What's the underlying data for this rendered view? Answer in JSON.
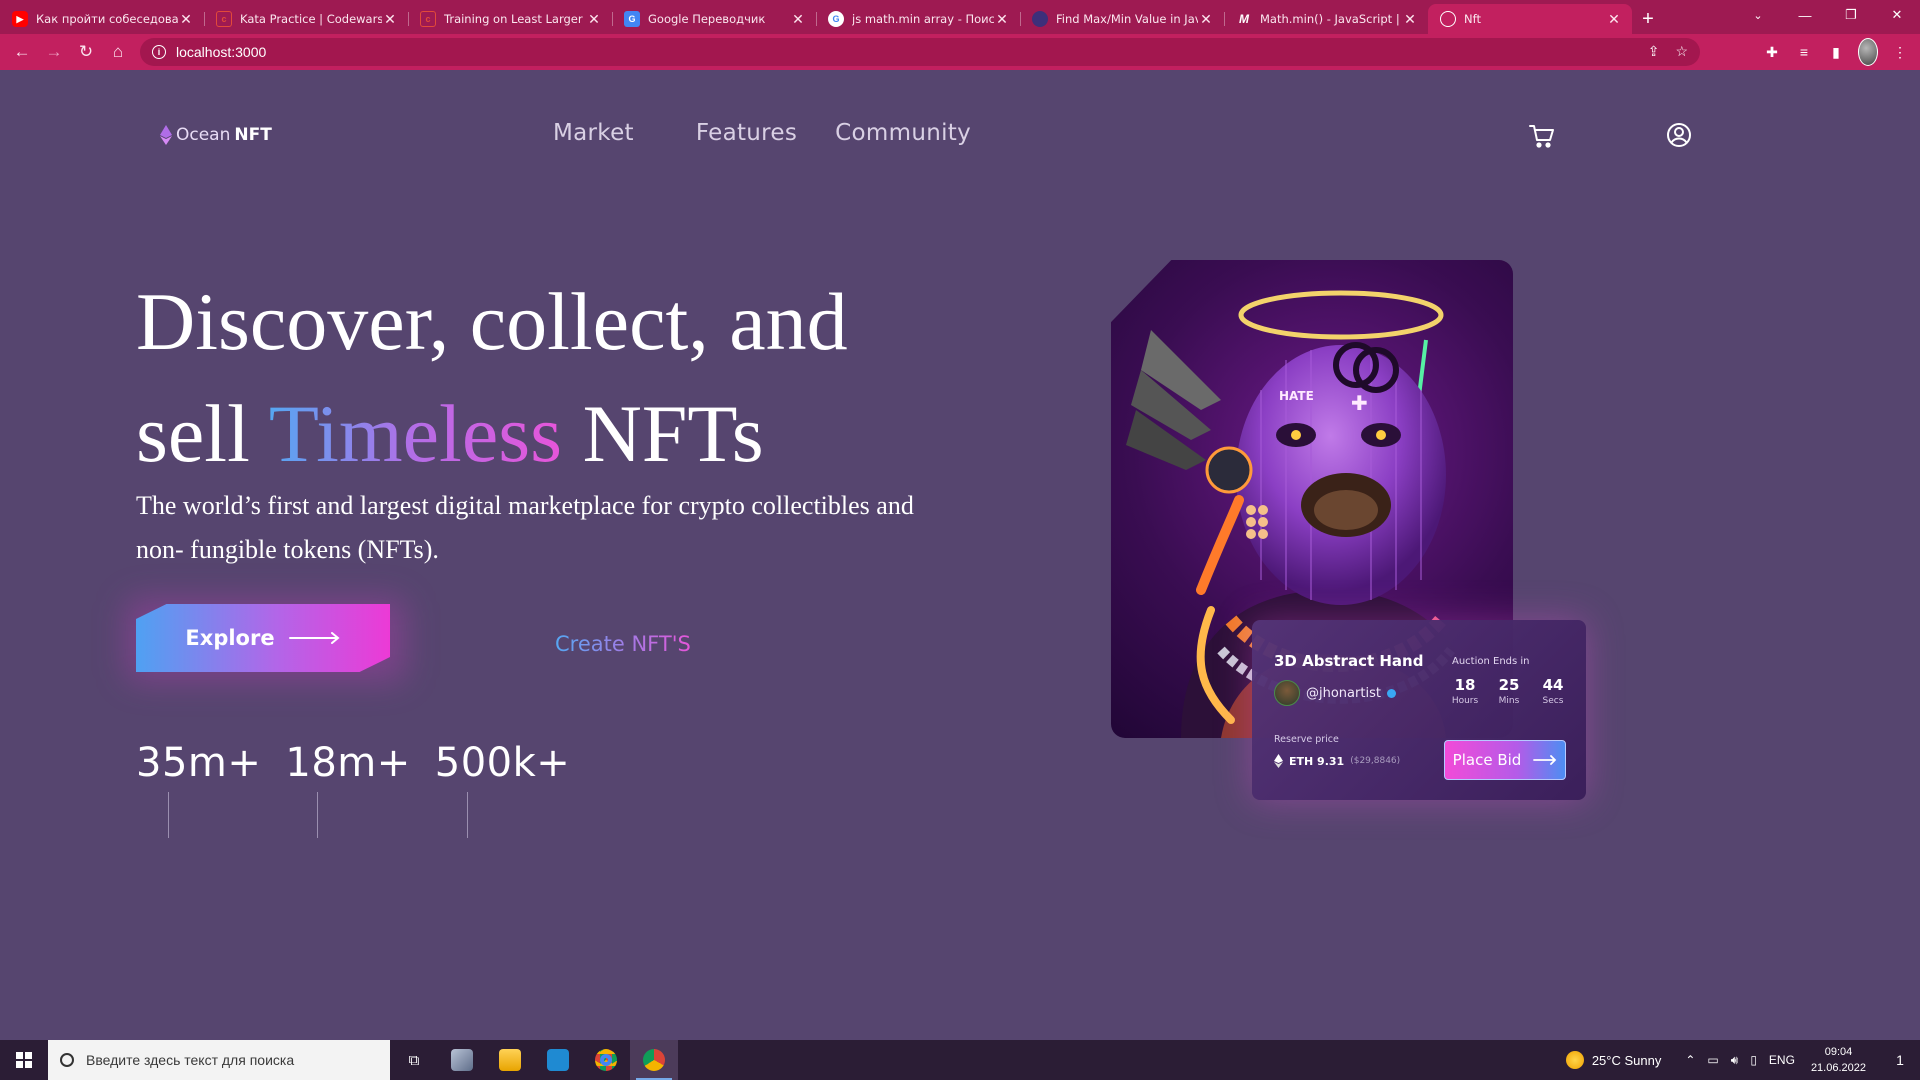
{
  "browser": {
    "tabs": [
      {
        "title": "Как пройти собеседован",
        "favicon": "youtube-icon",
        "color": "#ff0000"
      },
      {
        "title": "Kata Practice | Codewars",
        "favicon": "codewars-icon",
        "color": "#b1361e"
      },
      {
        "title": "Training on Least Larger | C",
        "favicon": "codewars-icon",
        "color": "#b1361e"
      },
      {
        "title": "Google Переводчик",
        "favicon": "google-translate-icon",
        "color": "#4285f4"
      },
      {
        "title": "js math.min array - Поиск",
        "favicon": "google-icon",
        "color": "#ffffff"
      },
      {
        "title": "Find Max/Min Value in Java",
        "favicon": "stackabuse-icon",
        "color": "#3d2f7a"
      },
      {
        "title": "Math.min() - JavaScript | M",
        "favicon": "mdn-icon",
        "color": "#000000"
      },
      {
        "title": "Nft",
        "favicon": "globe-icon",
        "color": "#ffffff",
        "active": true
      }
    ],
    "url": "localhost:3000"
  },
  "site": {
    "brand_ocean": "Ocean",
    "brand_nft": "NFT",
    "nav": [
      "Market",
      "Features",
      "Community"
    ],
    "hero": {
      "line1": "Discover, collect, and",
      "line2_pre": "sell ",
      "line2_highlight": "Timeless",
      "line2_post": " NFTs",
      "subtitle": "The world’s first and largest digital marketplace for crypto collectibles and non- fungible tokens (NFTs)."
    },
    "explore_label": "Explore",
    "create_label": "Create NFT'S",
    "stats": [
      "35m+",
      "18m+",
      "500k+"
    ],
    "auction": {
      "title": "3D Abstract Hand",
      "user": "@jhonartist",
      "ends_label": "Auction Ends in",
      "timer": [
        {
          "value": "18",
          "label": "Hours"
        },
        {
          "value": "25",
          "label": "Mins"
        },
        {
          "value": "44",
          "label": "Secs"
        }
      ],
      "reserve_label": "Reserve price",
      "price": "ETH 9.31",
      "price_usd": "($29,8846)",
      "bid_label": "Place Bid"
    },
    "art_text": "HATE"
  },
  "taskbar": {
    "search_placeholder": "Введите здесь текст для поиска",
    "weather": "25°C  Sunny",
    "lang": "ENG",
    "time": "09:04",
    "date": "21.06.2022",
    "notifications": "1"
  },
  "colors": {
    "page_bg": "#56456f",
    "chrome": "#c2205f",
    "accent_pink": "#ec3ad6",
    "accent_blue": "#4fa1f2"
  }
}
